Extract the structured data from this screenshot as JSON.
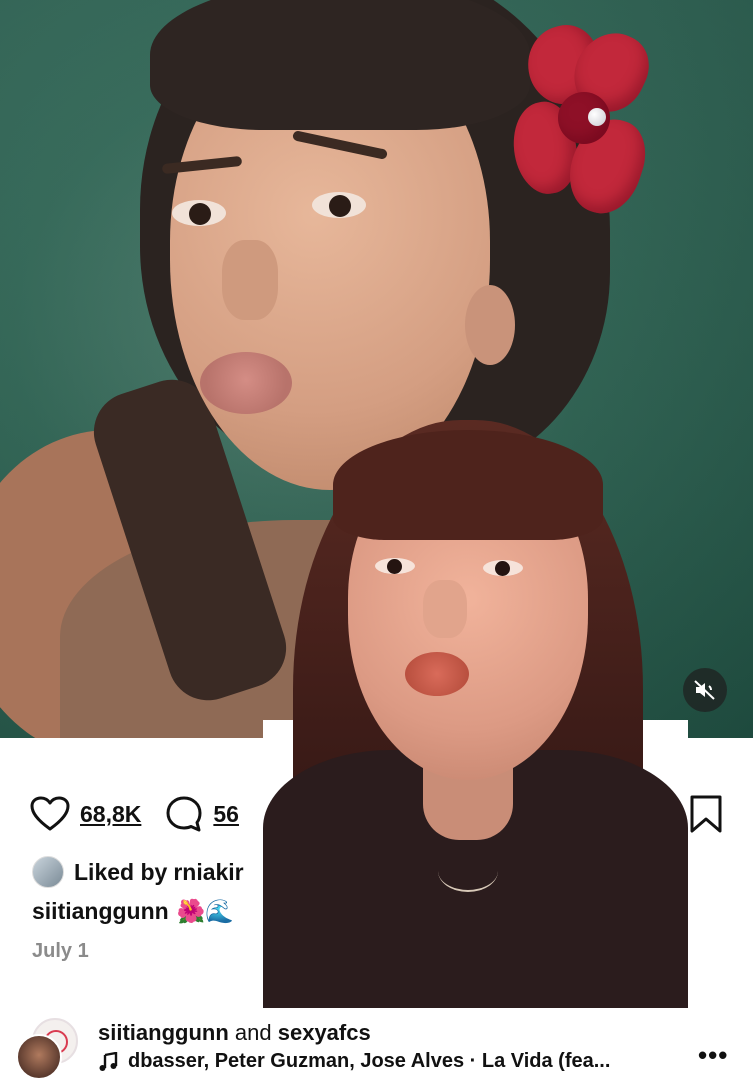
{
  "post": {
    "likes_count": "68,8K",
    "comments_count": "56",
    "liked_by_prefix": "Liked by",
    "liked_by_user": "rniakir",
    "caption_user": "siitianggunn",
    "caption_emoji": "🌺🌊",
    "date": "July 1"
  },
  "audio_row": {
    "user_one": "siitianggunn",
    "conjunction": "and",
    "user_two": "sexyafcs",
    "track": "dbasser, Peter Guzman, Jose Alves · La Vida (fea..."
  },
  "icons": {
    "like": "heart-icon",
    "comment": "comment-bubble-icon",
    "save": "bookmark-icon",
    "mute": "speaker-muted-icon",
    "music": "music-note-icon",
    "more": "more-dots-icon"
  }
}
